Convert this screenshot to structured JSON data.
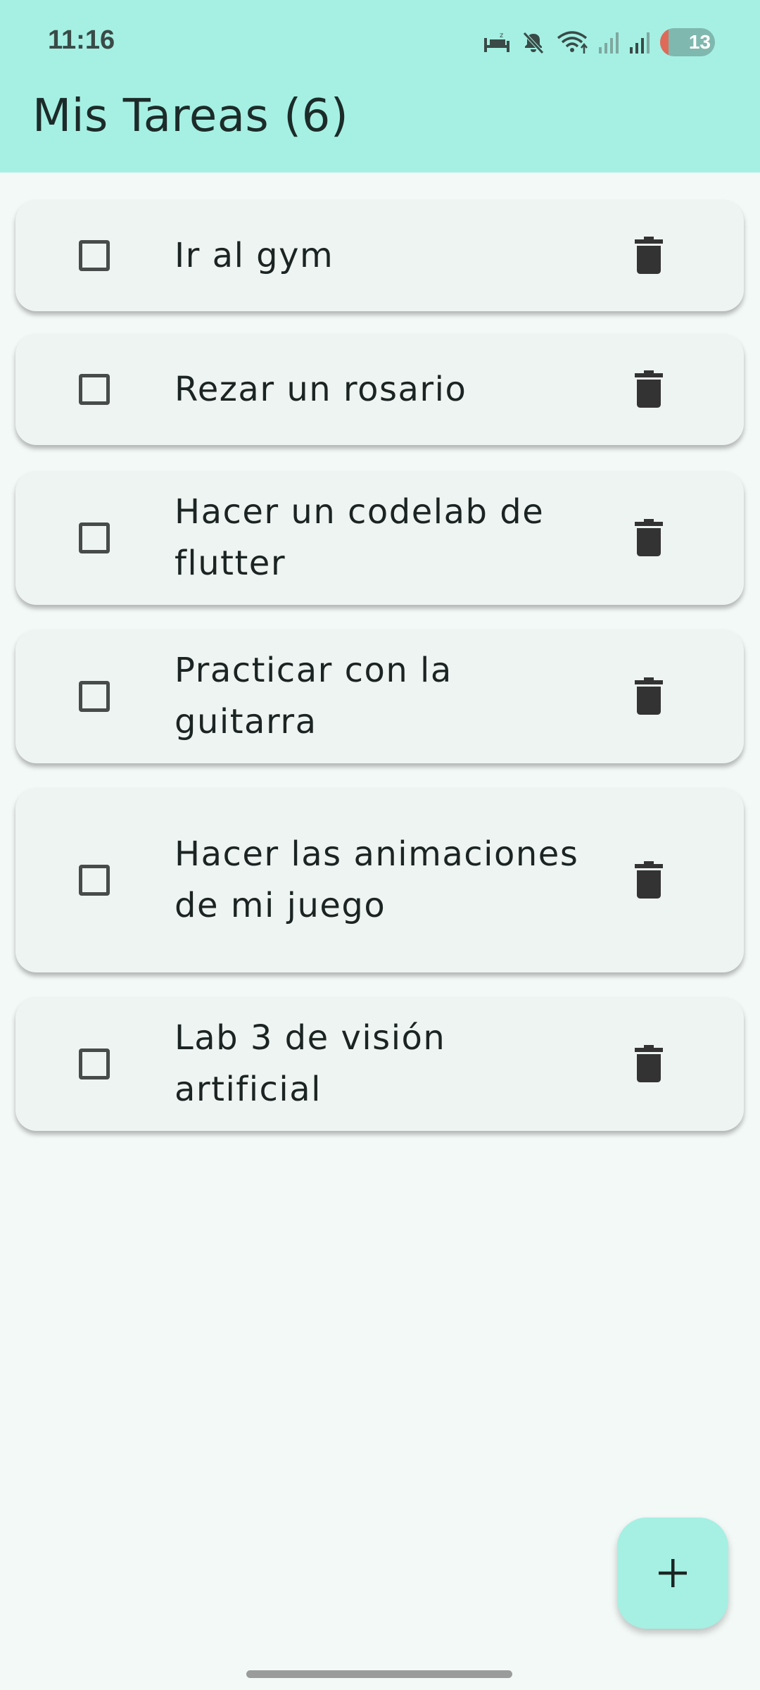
{
  "status_bar": {
    "time": "11:16",
    "battery": "13",
    "icons": [
      "sleep-icon",
      "mute-icon",
      "wifi-icon",
      "signal-icon",
      "signal-icon",
      "battery-icon"
    ]
  },
  "header": {
    "title": "Mis Tareas (6)"
  },
  "tasks": [
    {
      "title": "Ir al gym",
      "checked": false
    },
    {
      "title": "Rezar un rosario",
      "checked": false
    },
    {
      "title": "Hacer un codelab de flutter",
      "checked": false
    },
    {
      "title": "Practicar con la guitarra",
      "checked": false
    },
    {
      "title": "Hacer las animaciones de mi juego",
      "checked": false
    },
    {
      "title": "Lab 3 de visión artificial",
      "checked": false
    }
  ],
  "fab": {
    "icon": "add-icon",
    "symbol": "+"
  },
  "colors": {
    "accent": "#a5f0e3",
    "background": "#f3f9f7",
    "card": "#eef4f2",
    "icon": "#333333"
  }
}
